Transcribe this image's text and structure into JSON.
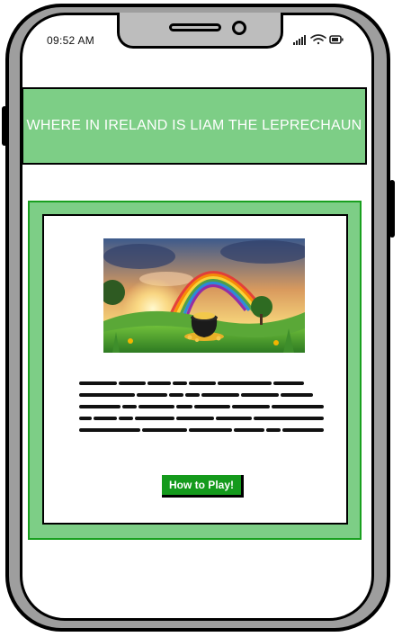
{
  "status_bar": {
    "time": "09:52 AM",
    "icons": [
      "signal-icon",
      "wifi-icon",
      "battery-icon"
    ]
  },
  "header": {
    "title": "WHERE IN IRELAND IS LIAM THE LEPRECHAUN"
  },
  "hero_image": {
    "subject": "rainbow-pot-of-gold"
  },
  "main": {
    "play_button_label": "How to Play!"
  },
  "colors": {
    "banner_green": "#7dce86",
    "panel_border_green": "#19a01f",
    "button_green": "#149a1c",
    "frame_grey": "#9e9e9e"
  }
}
